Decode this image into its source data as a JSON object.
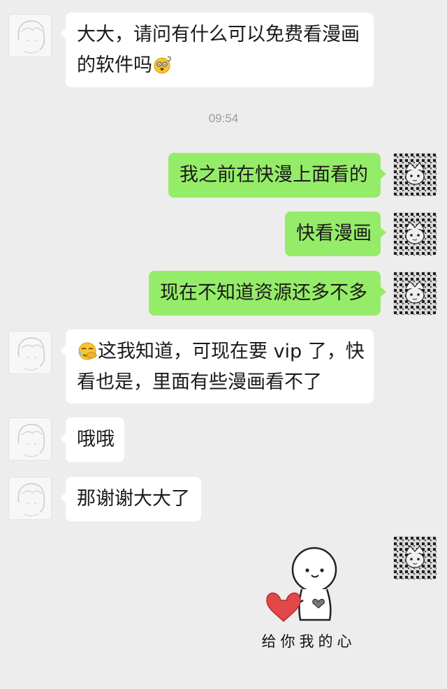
{
  "messages": [
    {
      "side": "left",
      "lines": [
        "大大，请问有什么可以免费看漫画",
        "的软件吗"
      ],
      "emoji": "dizzy-face-emoji"
    },
    {
      "side": "right",
      "text": "我之前在快漫上面看的"
    },
    {
      "side": "right",
      "text": "快看漫画"
    },
    {
      "side": "right",
      "text": "现在不知道资源还多不多"
    },
    {
      "side": "left",
      "lines": [
        "这我知道，可现在要 vip 了，快",
        "看也是，里面有些漫画看不了"
      ],
      "emoji": "facepalm-crying-emoji"
    },
    {
      "side": "left",
      "text": "哦哦"
    },
    {
      "side": "left",
      "text": "那谢谢大大了"
    }
  ],
  "timestamp": "09:54",
  "sticker": {
    "caption": "给你我的心",
    "icon": "stick-figure-heart-sticker"
  },
  "colors": {
    "background": "#ededed",
    "incoming_bubble": "#ffffff",
    "outgoing_bubble": "#95ec69",
    "timestamp": "#9b9b9b"
  },
  "avatars": {
    "incoming": "anime-sketch-avatar",
    "outgoing": "pattern-avatar"
  }
}
